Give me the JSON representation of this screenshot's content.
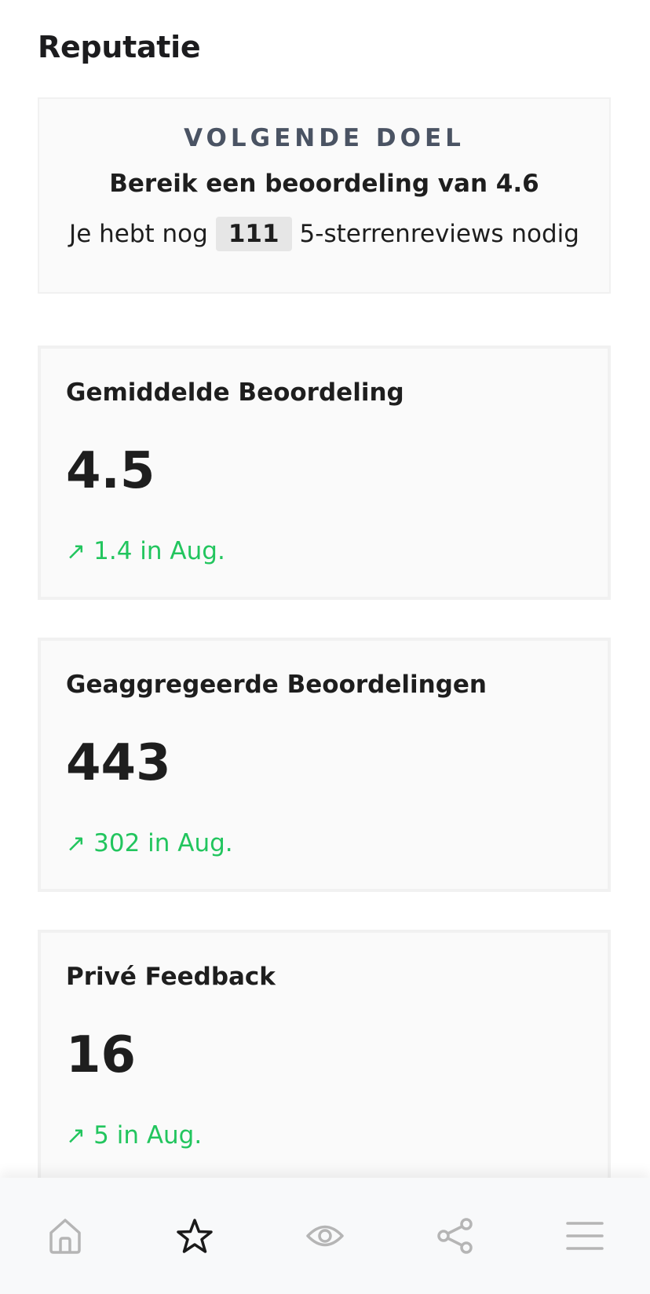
{
  "page": {
    "title": "Reputatie"
  },
  "goal": {
    "eyebrow": "VOLGENDE DOEL",
    "headline": "Bereik een beoordeling van 4.6",
    "detail_prefix": "Je hebt nog",
    "count": "111",
    "detail_suffix": "5-sterrenreviews nodig"
  },
  "stats": [
    {
      "label": "Gemiddelde Beoordeling",
      "value": "4.5",
      "trend": "1.4 in Aug.",
      "trend_icon": "arrow-up-right-icon"
    },
    {
      "label": "Geaggregeerde Beoordelingen",
      "value": "443",
      "trend": "302 in Aug.",
      "trend_icon": "arrow-up-right-icon"
    },
    {
      "label": "Privé Feedback",
      "value": "16",
      "trend": "5 in Aug.",
      "trend_icon": "arrow-up-right-icon"
    }
  ],
  "nav": {
    "items": [
      {
        "icon": "home-icon",
        "active": false
      },
      {
        "icon": "star-icon",
        "active": true
      },
      {
        "icon": "eye-icon",
        "active": false
      },
      {
        "icon": "share-icon",
        "active": false
      },
      {
        "icon": "menu-icon",
        "active": false
      }
    ]
  },
  "colors": {
    "trend_positive": "#22c55e",
    "eyebrow": "#4a5363",
    "nav_inactive": "#b5b5b5",
    "nav_active": "#1a1a1a"
  }
}
